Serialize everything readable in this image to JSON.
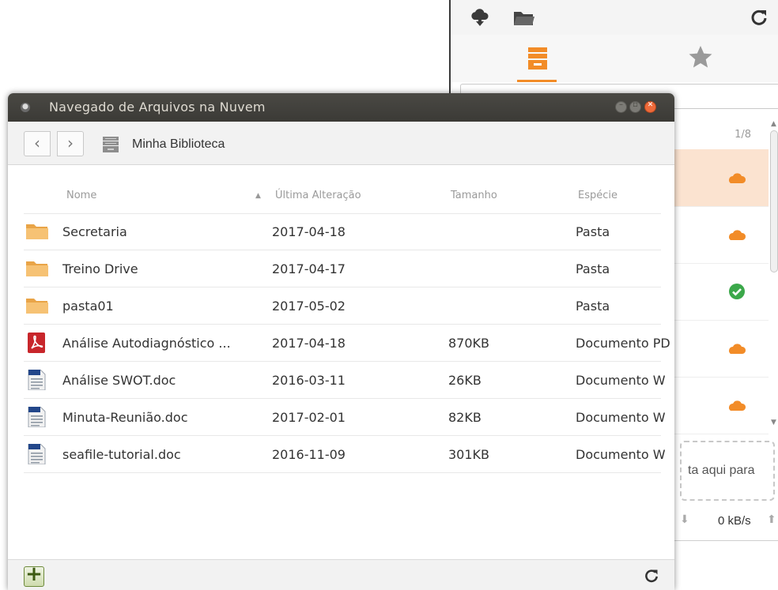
{
  "background_window": {
    "pager": "1/8",
    "drop_hint": "ta aqui para",
    "transfer_rate": "0 kB/s",
    "accent_color": "#f28c28",
    "synced_color": "#3ba84a"
  },
  "dialog": {
    "title": "Navegado de Arquivos na Nuvem",
    "breadcrumb": "Minha Biblioteca",
    "columns": {
      "name": "Nome",
      "modified": "Última Alteração",
      "size": "Tamanho",
      "kind": "Espécie"
    },
    "files": [
      {
        "icon": "folder-icon",
        "name": "Secretaria",
        "modified": "2017-04-18",
        "size": "",
        "kind": "Pasta"
      },
      {
        "icon": "folder-icon",
        "name": "Treino Drive",
        "modified": "2017-04-17",
        "size": "",
        "kind": "Pasta"
      },
      {
        "icon": "folder-icon",
        "name": "pasta01",
        "modified": "2017-05-02",
        "size": "",
        "kind": "Pasta"
      },
      {
        "icon": "pdf-icon",
        "name": "Análise Autodiagnóstico ...",
        "modified": "2017-04-18",
        "size": "870KB",
        "kind": "Documento PD"
      },
      {
        "icon": "doc-icon",
        "name": "Análise SWOT.doc",
        "modified": "2016-03-11",
        "size": "26KB",
        "kind": "Documento W"
      },
      {
        "icon": "doc-icon",
        "name": "Minuta-Reunião.doc",
        "modified": "2017-02-01",
        "size": "82KB",
        "kind": "Documento W"
      },
      {
        "icon": "doc-icon",
        "name": "seafile-tutorial.doc",
        "modified": "2016-11-09",
        "size": "301KB",
        "kind": "Documento W"
      }
    ]
  }
}
